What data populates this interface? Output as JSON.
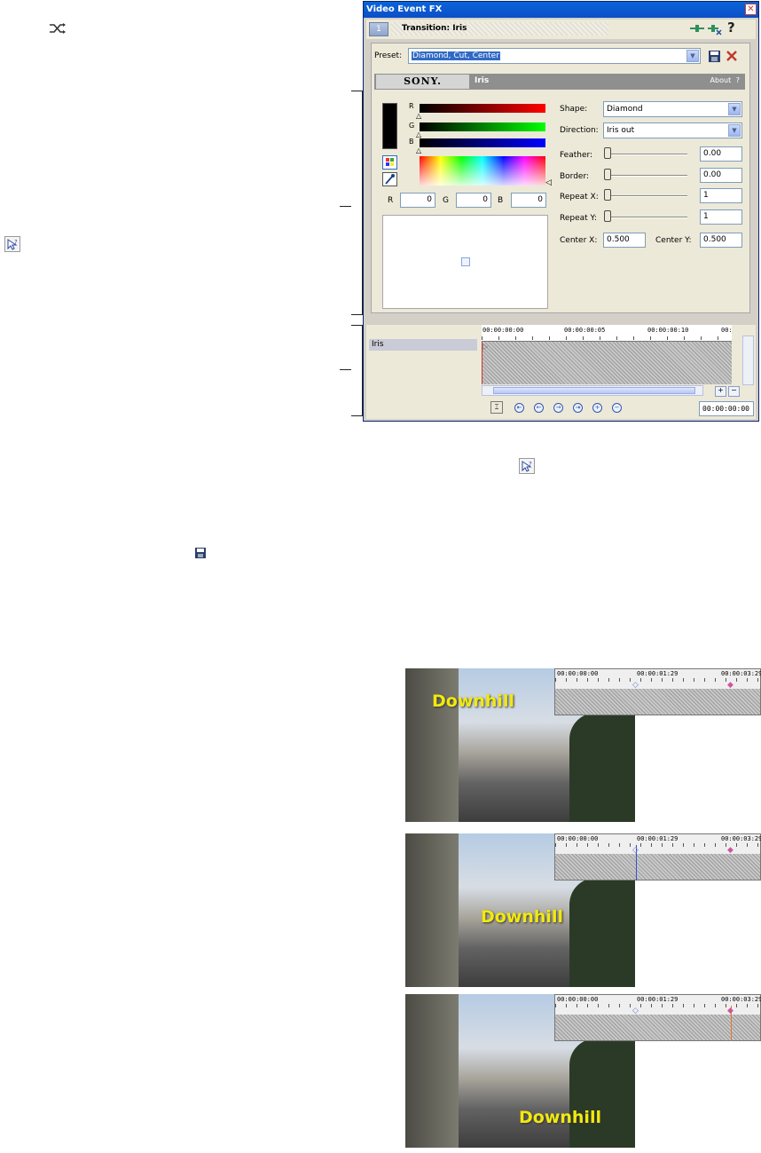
{
  "left_icons": {
    "shuffle_icon": "shuffle-icon",
    "help_pointer_icon": "help-pointer-icon"
  },
  "window": {
    "title": "Video Event FX",
    "close_glyph": "✕",
    "tab_number": "1",
    "tab_title": "Transition: Iris",
    "help_glyph": "?",
    "preset_label": "Preset:",
    "preset_value": "Diamond, Cut, Center",
    "brand": "SONY.",
    "plugin_name": "Iris",
    "about_label": "About",
    "about_help": "?"
  },
  "color": {
    "r_label": "R",
    "g_label": "G",
    "b_label": "B",
    "r_value": "0",
    "g_value": "0",
    "b_value": "0"
  },
  "params": {
    "shape_label": "Shape:",
    "shape_value": "Diamond",
    "direction_label": "Direction:",
    "direction_value": "Iris out",
    "feather_label": "Feather:",
    "feather_value": "0.00",
    "border_label": "Border:",
    "border_value": "0.00",
    "repeatx_label": "Repeat X:",
    "repeatx_value": "1",
    "repeaty_label": "Repeat Y:",
    "repeaty_value": "1",
    "centerx_label": "Center X:",
    "centerx_value": "0.500",
    "centery_label": "Center Y:",
    "centery_value": "0.500"
  },
  "timeline": {
    "track_label": "Iris",
    "ticks": [
      "00:00:00:00",
      "00:00:00:05",
      "00:00:00:10",
      "00:"
    ],
    "timecode": "00:00:00:00"
  },
  "examples": {
    "caption": "Downhill",
    "ticks": [
      "00:00:00:00",
      "00:00:01:29",
      "00:00:03:29"
    ]
  }
}
